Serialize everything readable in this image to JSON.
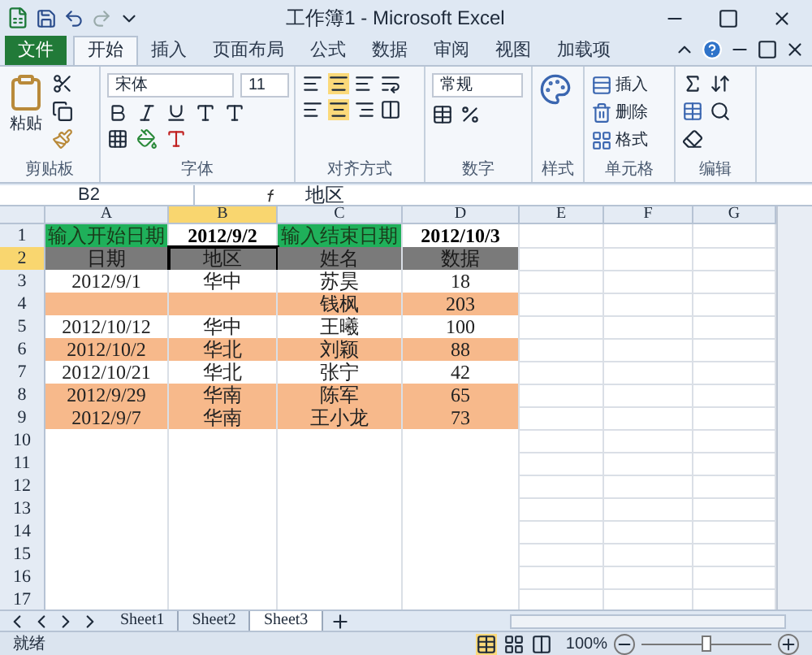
{
  "window": {
    "title": "工作簿1 - Microsoft Excel"
  },
  "ribbon_tabs": [
    {
      "label": "文件",
      "kind": "file",
      "selected": false
    },
    {
      "label": "开始",
      "kind": "tab",
      "selected": true
    },
    {
      "label": "插入",
      "kind": "tab",
      "selected": false
    },
    {
      "label": "页面布局",
      "kind": "tab",
      "selected": false
    },
    {
      "label": "公式",
      "kind": "tab",
      "selected": false
    },
    {
      "label": "数据",
      "kind": "tab",
      "selected": false
    },
    {
      "label": "审阅",
      "kind": "tab",
      "selected": false
    },
    {
      "label": "视图",
      "kind": "tab",
      "selected": false
    },
    {
      "label": "加载项",
      "kind": "tab",
      "selected": false
    }
  ],
  "ribbon": {
    "clipboard": {
      "label": "剪贴板",
      "paste": "粘贴"
    },
    "font": {
      "label": "字体",
      "name": "宋体",
      "size": "11"
    },
    "alignment": {
      "label": "对齐方式"
    },
    "number": {
      "label": "数字",
      "format": "常规"
    },
    "styles": {
      "label": "样式"
    },
    "cells": {
      "label": "单元格",
      "items": [
        "插入",
        "删除",
        "格式"
      ]
    },
    "editing": {
      "label": "编辑"
    }
  },
  "formula_bar": {
    "name_box": "B2",
    "value": "地区"
  },
  "columns": [
    {
      "label": "A",
      "selected": false
    },
    {
      "label": "B",
      "selected": true
    },
    {
      "label": "C",
      "selected": false
    },
    {
      "label": "D",
      "selected": false
    },
    {
      "label": "E",
      "selected": false
    },
    {
      "label": "F",
      "selected": false
    },
    {
      "label": "G",
      "selected": false
    }
  ],
  "rows": [
    {
      "number": "1",
      "selected": false,
      "kind": "params",
      "cells": [
        "输入开始日期",
        "2012/9/2",
        "输入结束日期",
        "2012/10/3"
      ]
    },
    {
      "number": "2",
      "selected": true,
      "kind": "header",
      "cells": [
        "日期",
        "地区",
        "姓名",
        "数据"
      ]
    },
    {
      "number": "3",
      "selected": false,
      "kind": "data",
      "highlighted": false,
      "cells": [
        "2012/9/1",
        "华中",
        "苏昊",
        "18"
      ]
    },
    {
      "number": "4",
      "selected": false,
      "kind": "data",
      "highlighted": true,
      "cells": [
        null,
        null,
        "钱枫",
        "203"
      ]
    },
    {
      "number": "5",
      "selected": false,
      "kind": "data",
      "highlighted": false,
      "cells": [
        "2012/10/12",
        "华中",
        "王曦",
        "100"
      ]
    },
    {
      "number": "6",
      "selected": false,
      "kind": "data",
      "highlighted": true,
      "cells": [
        "2012/10/2",
        "华北",
        "刘颖",
        "88"
      ]
    },
    {
      "number": "7",
      "selected": false,
      "kind": "data",
      "highlighted": false,
      "cells": [
        "2012/10/21",
        "华北",
        "张宁",
        "42"
      ]
    },
    {
      "number": "8",
      "selected": false,
      "kind": "data",
      "highlighted": true,
      "cells": [
        "2012/9/29",
        "华南",
        "陈军",
        "65"
      ]
    },
    {
      "number": "9",
      "selected": false,
      "kind": "data",
      "highlighted": true,
      "cells": [
        "2012/9/7",
        "华南",
        "王小龙",
        "73"
      ]
    },
    {
      "number": "10",
      "selected": false,
      "kind": "blank"
    },
    {
      "number": "11",
      "selected": false,
      "kind": "blank"
    },
    {
      "number": "12",
      "selected": false,
      "kind": "blank"
    },
    {
      "number": "13",
      "selected": false,
      "kind": "blank"
    },
    {
      "number": "14",
      "selected": false,
      "kind": "blank"
    },
    {
      "number": "15",
      "selected": false,
      "kind": "blank"
    },
    {
      "number": "16",
      "selected": false,
      "kind": "blank"
    },
    {
      "number": "17",
      "selected": false,
      "kind": "blank"
    }
  ],
  "sheet_tabs": [
    {
      "label": "Sheet1",
      "selected": false
    },
    {
      "label": "Sheet2",
      "selected": false
    },
    {
      "label": "Sheet3",
      "selected": true
    }
  ],
  "status_bar": {
    "status": "就绪",
    "zoom": "100%"
  },
  "zoom_slider": {
    "level": 0.5
  }
}
